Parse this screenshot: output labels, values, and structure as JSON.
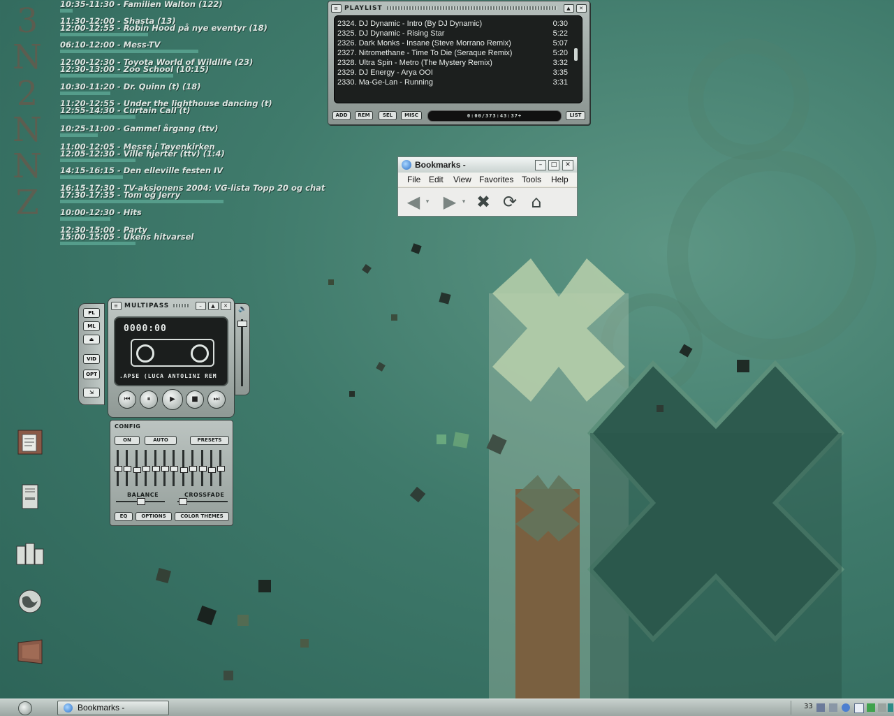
{
  "schedule": {
    "groups": [
      {
        "lines": [
          "10:35-11:30 - Familien Walton (122)"
        ]
      },
      {
        "lines": [
          "11:30-12:00 - Shasta (13)",
          "12:00-12:55 - Robin Hood på nye eventyr (18)"
        ]
      },
      {
        "lines": [
          "06:10-12:00 - Mess-TV"
        ]
      },
      {
        "lines": [
          "12:00-12:30 - Toyota World of Wildlife (23)",
          "12:30-13:00 - Zoo School (10:15)"
        ]
      },
      {
        "lines": [
          "10:30-11:20 - Dr. Quinn (t)  (18)"
        ]
      },
      {
        "lines": [
          "11:20-12:55 - Under the lighthouse dancing (t)",
          "12:55-14:30 - Curtain Call (t)"
        ]
      },
      {
        "lines": [
          "10:25-11:00 - Gammel årgang (ttv)"
        ]
      },
      {
        "lines": [
          "11:00-12:05 - Messe i Tøyenkirken",
          "12:05-12:30 - Ville hjerter (ttv)  (1:4)"
        ]
      },
      {
        "lines": [
          "14:15-16:15 - Den elleville festen IV"
        ]
      },
      {
        "lines": [
          "16:15-17:30 - TV-aksjonens 2004: VG-lista Topp 20 og chat",
          "17:30-17:35 - Tom og Jerry"
        ]
      },
      {
        "lines": [
          "10:00-12:30 - Hits"
        ]
      },
      {
        "lines": [
          "12:30-15:00 - Party",
          "15:00-15:05 - Ukens hitvarsel"
        ]
      }
    ],
    "progress": [
      0.05,
      0.35,
      0.55,
      0.45,
      0.2,
      0.3,
      0.15,
      0.3,
      0.25,
      0.65,
      0.2,
      0.3
    ]
  },
  "playlist": {
    "title": "PLAYLIST",
    "items": [
      {
        "label": "2324. DJ Dynamic - Intro (By DJ Dynamic)",
        "duration": "0:30"
      },
      {
        "label": "2325. DJ Dynamic - Rising Star",
        "duration": "5:22"
      },
      {
        "label": "2326. Dark Monks - Insane (Steve Morrano Remix)",
        "duration": "5:07"
      },
      {
        "label": "2327. Nitromethane - Time To Die (Seraque Remix)",
        "duration": "5:20"
      },
      {
        "label": "2328. Ultra Spin - Metro (The Mystery Remix)",
        "duration": "3:32"
      },
      {
        "label": "2329. DJ Energy - Arya OOI",
        "duration": "3:35"
      },
      {
        "label": "2330. Ma-Ge-Lan - Running",
        "duration": "3:31"
      }
    ],
    "buttons": {
      "add": "ADD",
      "rem": "REM",
      "sel": "SEL",
      "misc": "MISC",
      "list": "LIST"
    },
    "time": "0:00/373:43:37+"
  },
  "bookmarks": {
    "title": "Bookmarks -",
    "menu": [
      "File",
      "Edit",
      "View",
      "Favorites",
      "Tools",
      "Help"
    ]
  },
  "player": {
    "title": "MULTIPASS",
    "time": "0000:00",
    "ticker": ".APSE (LUCA ANTOLINI REM",
    "side_buttons": {
      "pl": "PL",
      "ml": "ML",
      "vid": "VID",
      "opt": "OPT"
    }
  },
  "equalizer": {
    "title": "CONFIG",
    "on": "ON",
    "auto": "AUTO",
    "presets": "PRESETS",
    "balance": "BALANCE",
    "crossfade": "CROSSFADE",
    "eq": "EQ",
    "options": "OPTIONS",
    "color_themes": "COLOR THEMES",
    "bands": [
      0.5,
      0.5,
      0.45,
      0.5,
      0.5,
      0.5,
      0.5,
      0.45,
      0.5,
      0.5,
      0.45,
      0.5
    ]
  },
  "taskbar": {
    "window_button": "Bookmarks -",
    "tray_text": "33"
  }
}
